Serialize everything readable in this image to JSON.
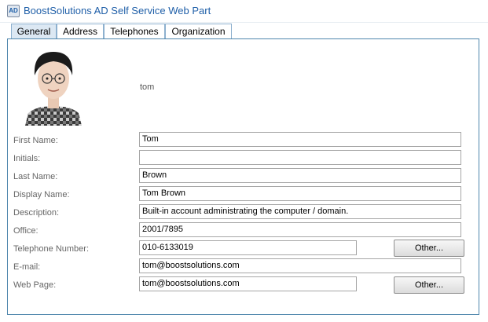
{
  "app": {
    "icon": "ad-self-service-icon",
    "title": "BoostSolutions AD Self Service Web Part"
  },
  "tabs": [
    {
      "label": "General",
      "active": true
    },
    {
      "label": "Address",
      "active": false
    },
    {
      "label": "Telephones",
      "active": false
    },
    {
      "label": "Organization",
      "active": false
    }
  ],
  "profile": {
    "avatar": "user-avatar-photo",
    "username": "tom"
  },
  "fields": {
    "first_name": {
      "label": "First Name:",
      "value": "Tom"
    },
    "initials": {
      "label": "Initials:",
      "value": ""
    },
    "last_name": {
      "label": "Last Name:",
      "value": "Brown"
    },
    "display_name": {
      "label": "Display Name:",
      "value": "Tom Brown"
    },
    "description": {
      "label": "Description:",
      "value": "Built-in account administrating the computer / domain."
    },
    "office": {
      "label": "Office:",
      "value": "2001/7895"
    },
    "telephone": {
      "label": "Telephone Number:",
      "value": "010-6133019",
      "other_label": "Other..."
    },
    "email": {
      "label": "E-mail:",
      "value": "tom@boostsolutions.com"
    },
    "web_page": {
      "label": "Web Page:",
      "value": "tom@boostsolutions.com",
      "other_label": "Other..."
    }
  },
  "colors": {
    "title": "#1f5fa8",
    "panel_border": "#4e86ac",
    "tab_border": "#8eb1cf"
  }
}
